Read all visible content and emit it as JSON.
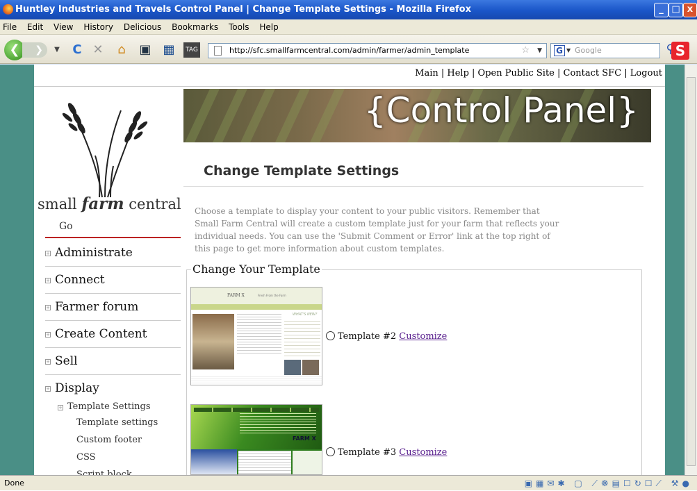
{
  "window": {
    "title": "Huntley Industries and Travels Control Panel | Change Template Settings - Mozilla Firefox"
  },
  "menu": [
    "File",
    "Edit",
    "View",
    "History",
    "Delicious",
    "Bookmarks",
    "Tools",
    "Help"
  ],
  "nav": {
    "url": "http://sfc.smallfarmcentral.com/admin/farmer/admin_template",
    "search_placeholder": "Google",
    "search_engine": "G"
  },
  "toplinks": "Main | Help | Open Public Site | Contact SFC | Logout",
  "logo": {
    "text_pre": "small ",
    "text_bold": "farm",
    "text_post": " central"
  },
  "sidebar": {
    "go": "Go",
    "items": [
      "Administrate",
      "Connect",
      "Farmer forum",
      "Create Content",
      "Sell",
      "Display"
    ],
    "sub_header": "Template Settings",
    "sub_items": [
      "Template settings",
      "Custom footer",
      "CSS",
      "Script block"
    ]
  },
  "banner": "{Control Panel}",
  "main": {
    "heading": "Change Template Settings",
    "intro": "Choose a template to display your content to your public visitors. Remember that Small Farm Central will create a custom template just for your farm that reflects your individual needs. You can use the 'Submit Comment or Error' link at the top right of this page to get more information about custom templates.",
    "fieldset_legend": "Change Your Template",
    "templates": [
      {
        "label": "Template #2",
        "action": "Customize",
        "thumb_title": "FARM X",
        "thumb_tagline": "Fresh From the Farm",
        "thumb_whats_new": "WHAT'S NEW?"
      },
      {
        "label": "Template #3",
        "action": "Customize",
        "thumb_title": "FARM X"
      }
    ]
  },
  "status": "Done",
  "colors": {
    "sidebar_rule": "#bb2222",
    "page_bg": "#4a8f86",
    "link": "#551a8b"
  }
}
